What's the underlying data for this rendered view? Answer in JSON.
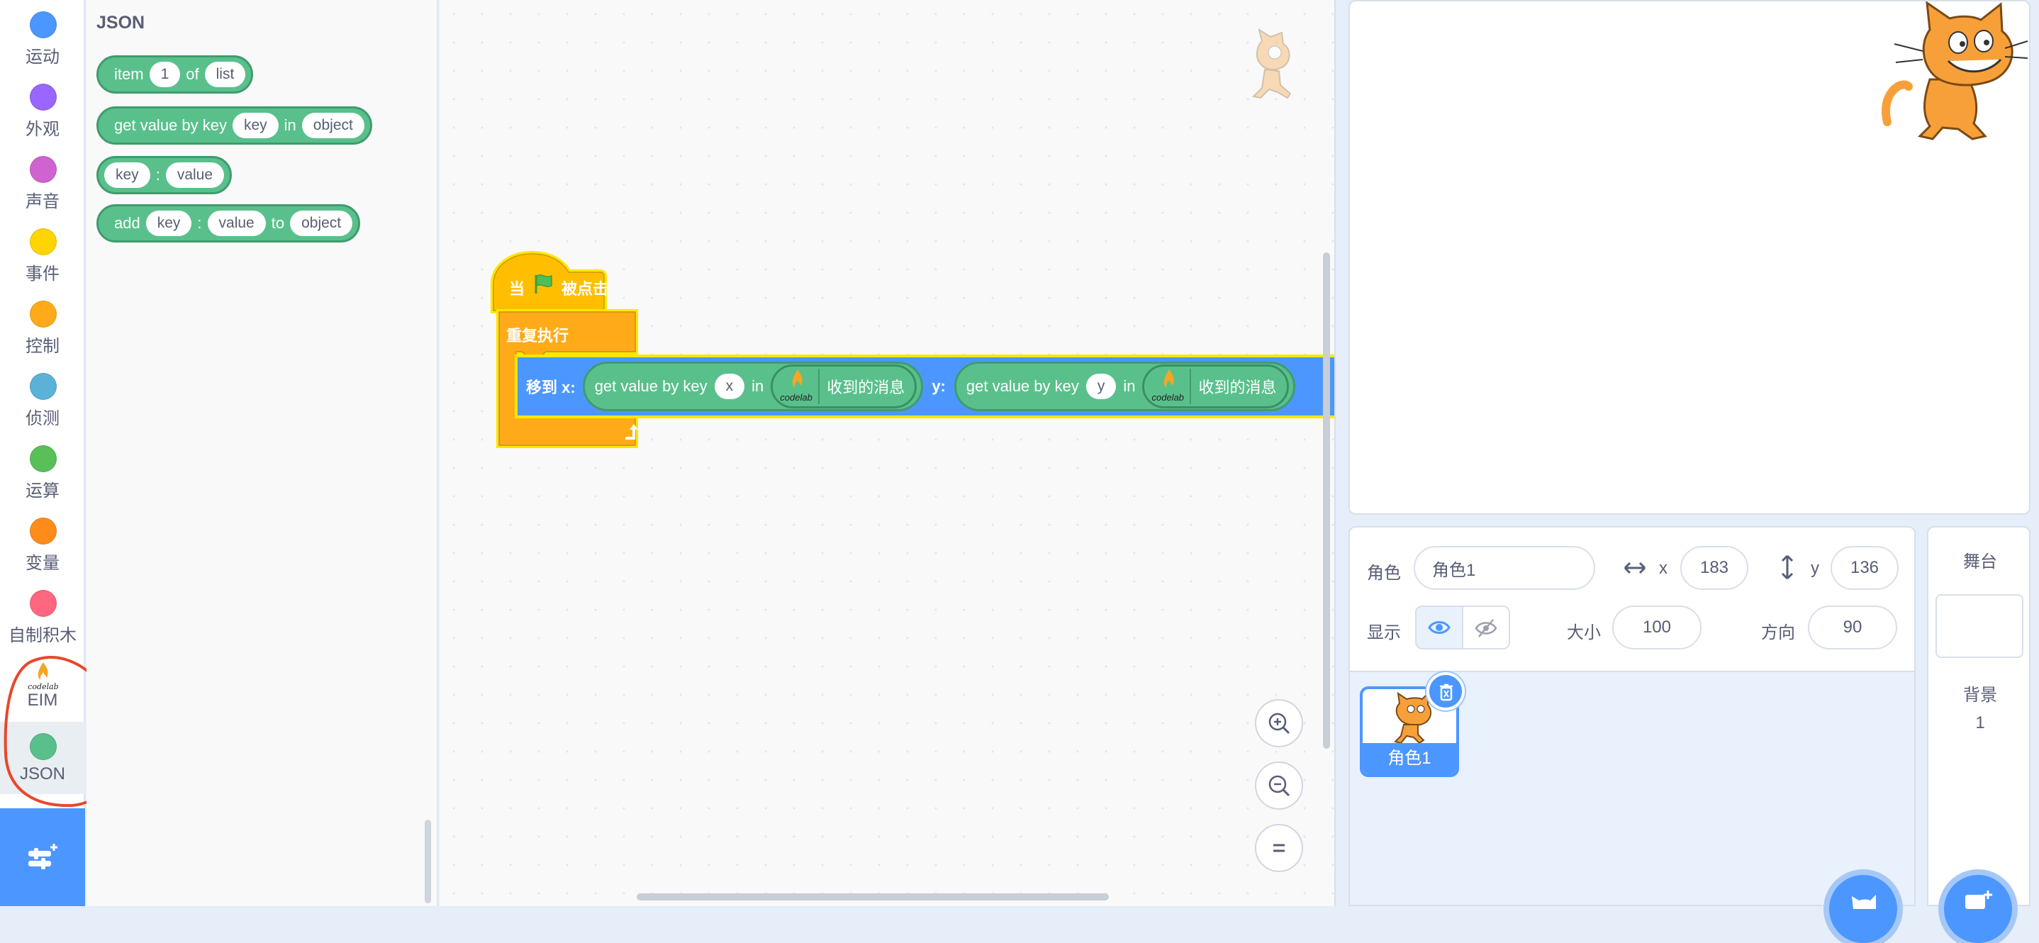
{
  "categories": [
    {
      "label": "运动",
      "color": "#4c97ff",
      "icon": "motion-dot"
    },
    {
      "label": "外观",
      "color": "#9966ff",
      "icon": "looks-dot"
    },
    {
      "label": "声音",
      "color": "#cf63cf",
      "icon": "sound-dot"
    },
    {
      "label": "事件",
      "color": "#ffd500",
      "icon": "events-dot"
    },
    {
      "label": "控制",
      "color": "#ffab19",
      "icon": "control-dot"
    },
    {
      "label": "侦测",
      "color": "#5cb1d6",
      "icon": "sensing-dot"
    },
    {
      "label": "运算",
      "color": "#59c059",
      "icon": "operators-dot"
    },
    {
      "label": "变量",
      "color": "#ff8c1a",
      "icon": "variables-dot"
    },
    {
      "label": "自制积木",
      "color": "#ff6680",
      "icon": "my-blocks-dot"
    },
    {
      "label": "EIM",
      "logo_text": "codelab",
      "icon": "codelab-flame-logo"
    },
    {
      "label": "JSON",
      "color": "#59c08c",
      "icon": "json-dot"
    }
  ],
  "flyout": {
    "title": "JSON",
    "blocks": {
      "item": {
        "word1": "item",
        "arg1": "1",
        "word2": "of",
        "arg2": "list"
      },
      "get_value": {
        "word1": "get value by key",
        "arg1": "key",
        "word2": "in",
        "arg2": "object"
      },
      "pair": {
        "arg1": "key",
        "word1": ":",
        "arg2": "value"
      },
      "add": {
        "word1": "add",
        "arg1": "key",
        "word2": ":",
        "arg2": "value",
        "word3": "to",
        "arg3": "object"
      }
    }
  },
  "script": {
    "hat_prefix": "当",
    "hat_suffix": "被点击",
    "forever_label": "重复执行",
    "move_x_label": "移到 x:",
    "move_y_label": "y:",
    "get_x": {
      "label": "get value by key",
      "key": "x",
      "in": "in",
      "logo_text": "codelab",
      "msg": "收到的消息"
    },
    "get_y": {
      "label": "get value by key",
      "key": "y",
      "in": "in",
      "logo_text": "codelab",
      "msg": "收到的消息"
    }
  },
  "sprite_info": {
    "sprite_label": "角色",
    "sprite_name": "角色1",
    "x_label": "x",
    "x_value": "183",
    "y_label": "y",
    "y_value": "136",
    "show_label": "显示",
    "size_label": "大小",
    "size_value": "100",
    "direction_label": "方向",
    "direction_value": "90"
  },
  "sprites": [
    {
      "name": "角色1"
    }
  ],
  "stage_panel": {
    "title": "舞台",
    "backdrop_label": "背景",
    "backdrop_count": "1"
  },
  "colors": {
    "accent": "#4c97ff",
    "json_green": "#59c08c",
    "highlight": "#ffe600",
    "annotation": "#e8472b"
  }
}
